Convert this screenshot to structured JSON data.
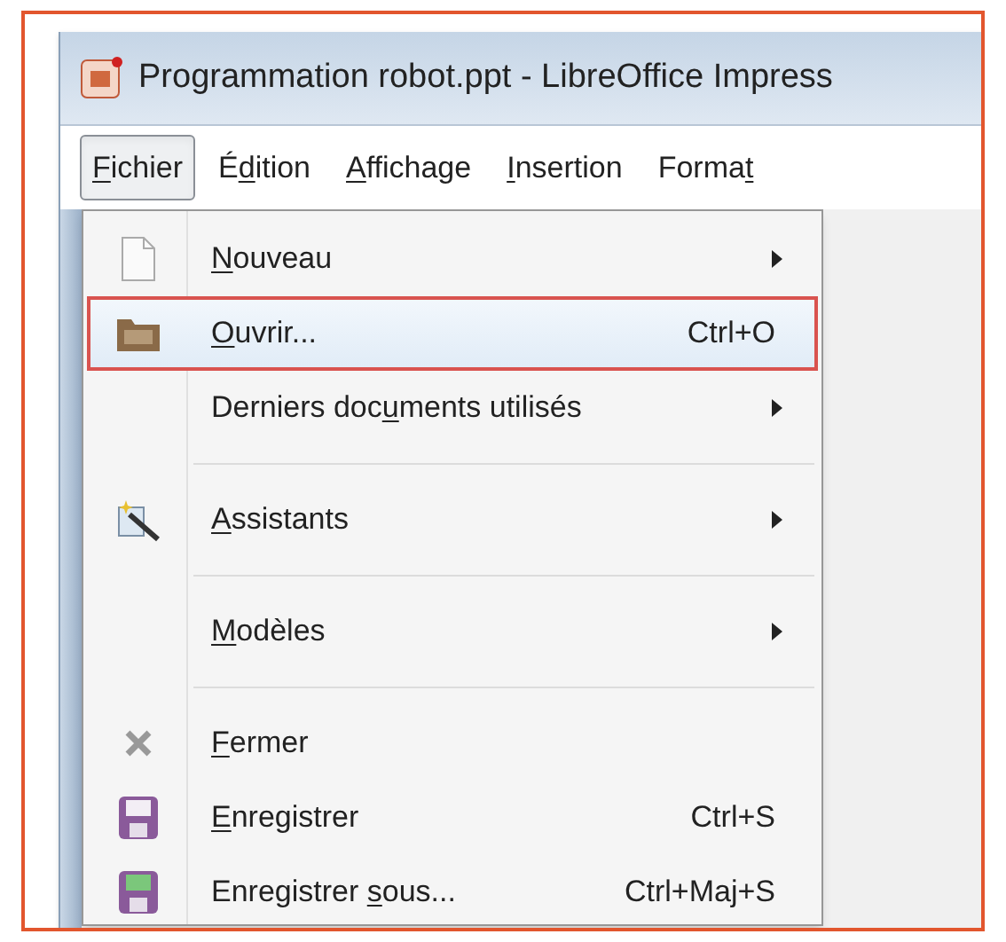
{
  "window": {
    "title": "Programmation robot.ppt - LibreOffice Impress"
  },
  "menu_bar": [
    {
      "label": {
        "key": "F",
        "post": "ichier"
      },
      "selected": true
    },
    {
      "label": {
        "pre": "É",
        "key": "d",
        "post": "ition"
      },
      "selected": false
    },
    {
      "label": {
        "key": "A",
        "post": "ffichage"
      },
      "selected": false
    },
    {
      "label": {
        "key": "I",
        "post": "nsertion"
      },
      "selected": false
    },
    {
      "label": {
        "pre": "Forma",
        "key": "t"
      },
      "selected": false
    }
  ],
  "file_menu": [
    {
      "kind": "item",
      "label": {
        "key": "N",
        "post": "ouveau"
      },
      "submenu": true,
      "selected": false
    },
    {
      "kind": "item",
      "label": {
        "key": "O",
        "post": "uvrir..."
      },
      "shortcut": "Ctrl+O",
      "submenu": false,
      "selected": true
    },
    {
      "kind": "item",
      "label": {
        "pre": "Derniers doc",
        "key": "u",
        "post": "ments utilisés"
      },
      "submenu": true,
      "selected": false
    },
    {
      "kind": "separator"
    },
    {
      "kind": "item",
      "label": {
        "key": "A",
        "post": "ssistants"
      },
      "submenu": true,
      "selected": false
    },
    {
      "kind": "separator"
    },
    {
      "kind": "item",
      "label": {
        "key": "M",
        "post": "odèles"
      },
      "submenu": true,
      "selected": false
    },
    {
      "kind": "separator"
    },
    {
      "kind": "item",
      "label": {
        "key": "F",
        "post": "ermer"
      },
      "submenu": false,
      "selected": false
    },
    {
      "kind": "item",
      "label": {
        "key": "E",
        "post": "nregistrer"
      },
      "shortcut": "Ctrl+S",
      "submenu": false,
      "selected": false
    },
    {
      "kind": "item",
      "label": {
        "pre": "Enregistrer ",
        "key": "s",
        "post": "ous..."
      },
      "shortcut": "Ctrl+Maj+S",
      "submenu": false,
      "selected": false
    }
  ]
}
